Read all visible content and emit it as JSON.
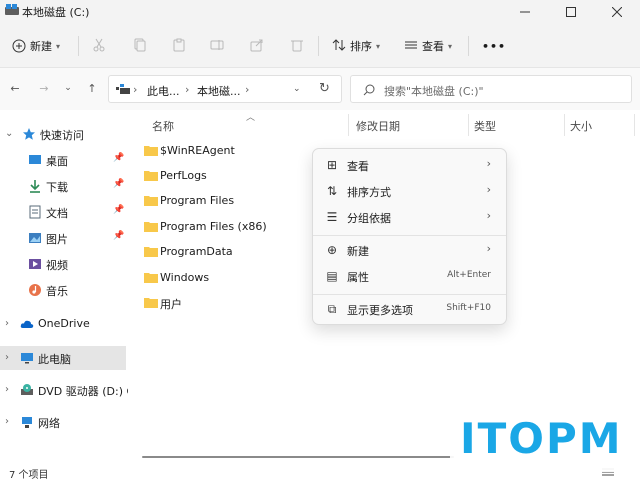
{
  "window": {
    "title": "本地磁盘 (C:)"
  },
  "toolbar": {
    "new_label": "新建",
    "sort_label": "排序",
    "view_label": "查看",
    "more_label": "•••"
  },
  "address": {
    "crumbs": [
      "此电...",
      "本地磁..."
    ],
    "search_placeholder": "搜索\"本地磁盘 (C:)\""
  },
  "sidebar": {
    "items": [
      {
        "label": "快速访问"
      },
      {
        "label": "桌面"
      },
      {
        "label": "下载"
      },
      {
        "label": "文档"
      },
      {
        "label": "图片"
      },
      {
        "label": "视频"
      },
      {
        "label": "音乐"
      },
      {
        "label": "OneDrive"
      },
      {
        "label": "此电脑"
      },
      {
        "label": "DVD 驱动器 (D:) CF"
      },
      {
        "label": "网络"
      }
    ]
  },
  "columns": {
    "name": "名称",
    "modified": "修改日期",
    "type": "类型",
    "size": "大小"
  },
  "files": [
    {
      "name": "$WinREAgent"
    },
    {
      "name": "PerfLogs"
    },
    {
      "name": "Program Files"
    },
    {
      "name": "Program Files (x86)"
    },
    {
      "name": "ProgramData"
    },
    {
      "name": "Windows"
    },
    {
      "name": "用户"
    }
  ],
  "context_menu": {
    "items": [
      {
        "label": "查看",
        "icon": "grid-icon",
        "submenu": true
      },
      {
        "label": "排序方式",
        "icon": "sort-icon",
        "submenu": true
      },
      {
        "label": "分组依据",
        "icon": "group-icon",
        "submenu": true
      },
      {
        "label": "新建",
        "icon": "plus-circle-icon",
        "submenu": true
      },
      {
        "label": "属性",
        "icon": "properties-icon",
        "shortcut": "Alt+Enter"
      },
      {
        "label": "显示更多选项",
        "icon": "more-options-icon",
        "shortcut": "Shift+F10"
      }
    ]
  },
  "status": {
    "count": "7 个项目"
  },
  "watermark": {
    "text": "ITOPM"
  },
  "colors": {
    "folder": "#f8c84a",
    "selected": "#e5e5e5",
    "accent": "#0067c0",
    "watermark": "#1aa7e6"
  }
}
